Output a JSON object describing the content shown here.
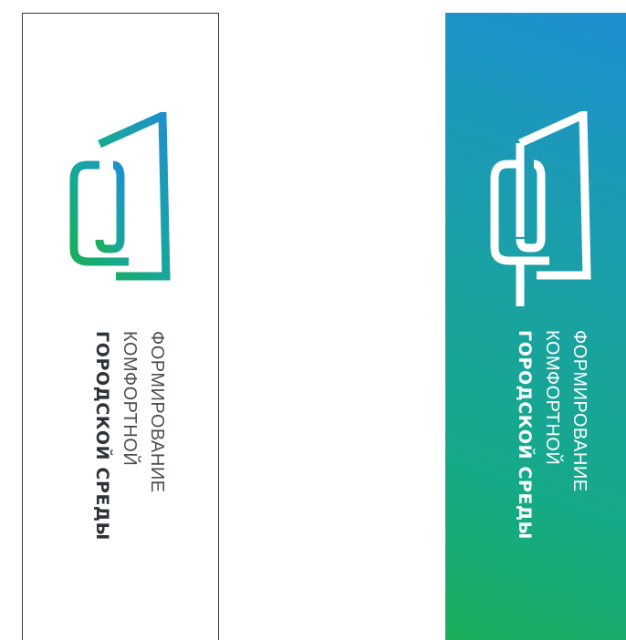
{
  "logo_lines": {
    "line1": "ФОРМИРОВАНИЕ",
    "line2": "КОМФОРТНОЙ",
    "line3": "ГОРОДСКОЙ СРЕДЫ"
  },
  "colors": {
    "gradient_blue": "#1e8fd0",
    "gradient_teal": "#15aa86",
    "gradient_green": "#1aae5c",
    "text_dark": "#2e333a",
    "text_light": "#ffffff"
  },
  "icons": [
    "city-environment-logo-icon"
  ]
}
